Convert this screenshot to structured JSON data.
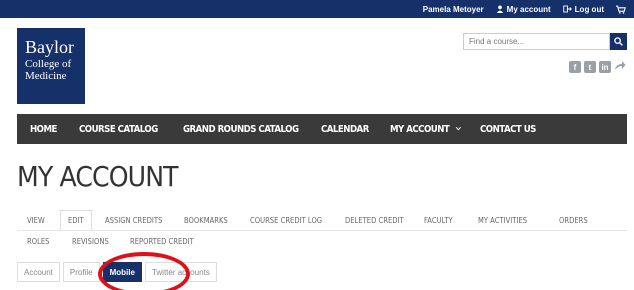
{
  "topbar": {
    "user_name": "Pamela Metoyer",
    "my_account": "My account",
    "log_out": "Log out"
  },
  "logo": {
    "line1": "Baylor",
    "line2": "College of",
    "line3": "Medicine"
  },
  "search": {
    "placeholder": "Find a course..."
  },
  "social_icons": [
    "facebook-icon",
    "twitter-icon",
    "linkedin-icon",
    "share-icon"
  ],
  "nav": {
    "home": "HOME",
    "course_catalog": "COURSE CATALOG",
    "grand_rounds": "GRAND ROUNDS CATALOG",
    "calendar": "CALENDAR",
    "my_account": "MY ACCOUNT",
    "contact_us": "CONTACT US"
  },
  "page_title": "MY ACCOUNT",
  "tabs": {
    "row1": [
      "VIEW",
      "EDIT",
      "ASSIGN CREDITS",
      "BOOKMARKS",
      "COURSE CREDIT LOG",
      "DELETED CREDIT",
      "FACULTY",
      "MY ACTIVITIES",
      "ORDERS"
    ],
    "row2": [
      "ROLES",
      "REVISIONS",
      "REPORTED CREDIT"
    ]
  },
  "subtabs": [
    "Account",
    "Profile",
    "Mobile",
    "Twitter accounts"
  ],
  "colors": {
    "brand_navy": "#163069",
    "navbar": "#3a3a3a",
    "highlight_circle": "#e0101a"
  }
}
